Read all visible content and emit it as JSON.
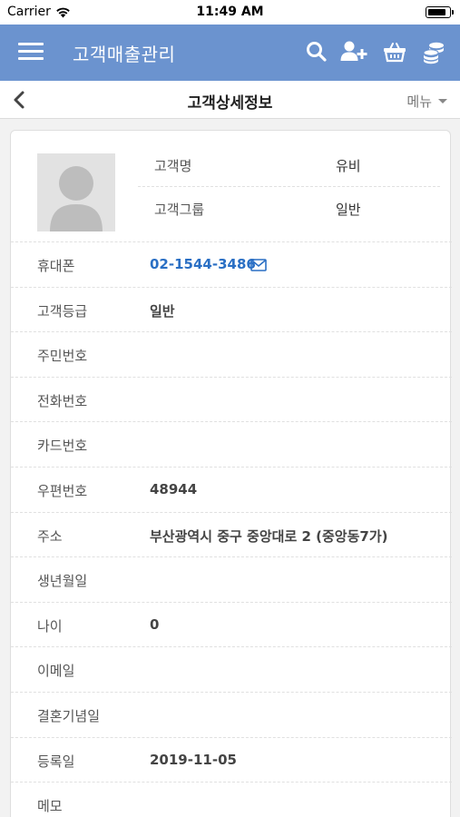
{
  "status_bar": {
    "carrier": "Carrier",
    "time": "11:49 AM",
    "battery_level": 0.9
  },
  "app_bar": {
    "title": "고객매출관리",
    "color": "#6b93cf",
    "icons": [
      "menu-icon",
      "search-icon",
      "add-user-icon",
      "basket-icon",
      "coins-icon"
    ]
  },
  "sub_bar": {
    "title": "고객상세정보",
    "menu_label": "메뉴"
  },
  "customer": {
    "name_label": "고객명",
    "name": "유비",
    "group_label": "고객그룹",
    "group": "일반"
  },
  "fields": [
    {
      "label": "휴대폰",
      "value": "02-1544-3486"
    },
    {
      "label": "고객등급",
      "value": "일반"
    },
    {
      "label": "주민번호",
      "value": ""
    },
    {
      "label": "전화번호",
      "value": ""
    },
    {
      "label": "카드번호",
      "value": ""
    },
    {
      "label": "우편번호",
      "value": "48944"
    },
    {
      "label": "주소",
      "value": "부산광역시 중구 중앙대로 2 (중앙동7가)"
    },
    {
      "label": "생년월일",
      "value": ""
    },
    {
      "label": "나이",
      "value": "0"
    },
    {
      "label": "이메일",
      "value": ""
    },
    {
      "label": "결혼기념일",
      "value": ""
    },
    {
      "label": "등록일",
      "value": "2019-11-05"
    },
    {
      "label": "메모",
      "value": ""
    }
  ],
  "link_color": "#2a6fc4"
}
